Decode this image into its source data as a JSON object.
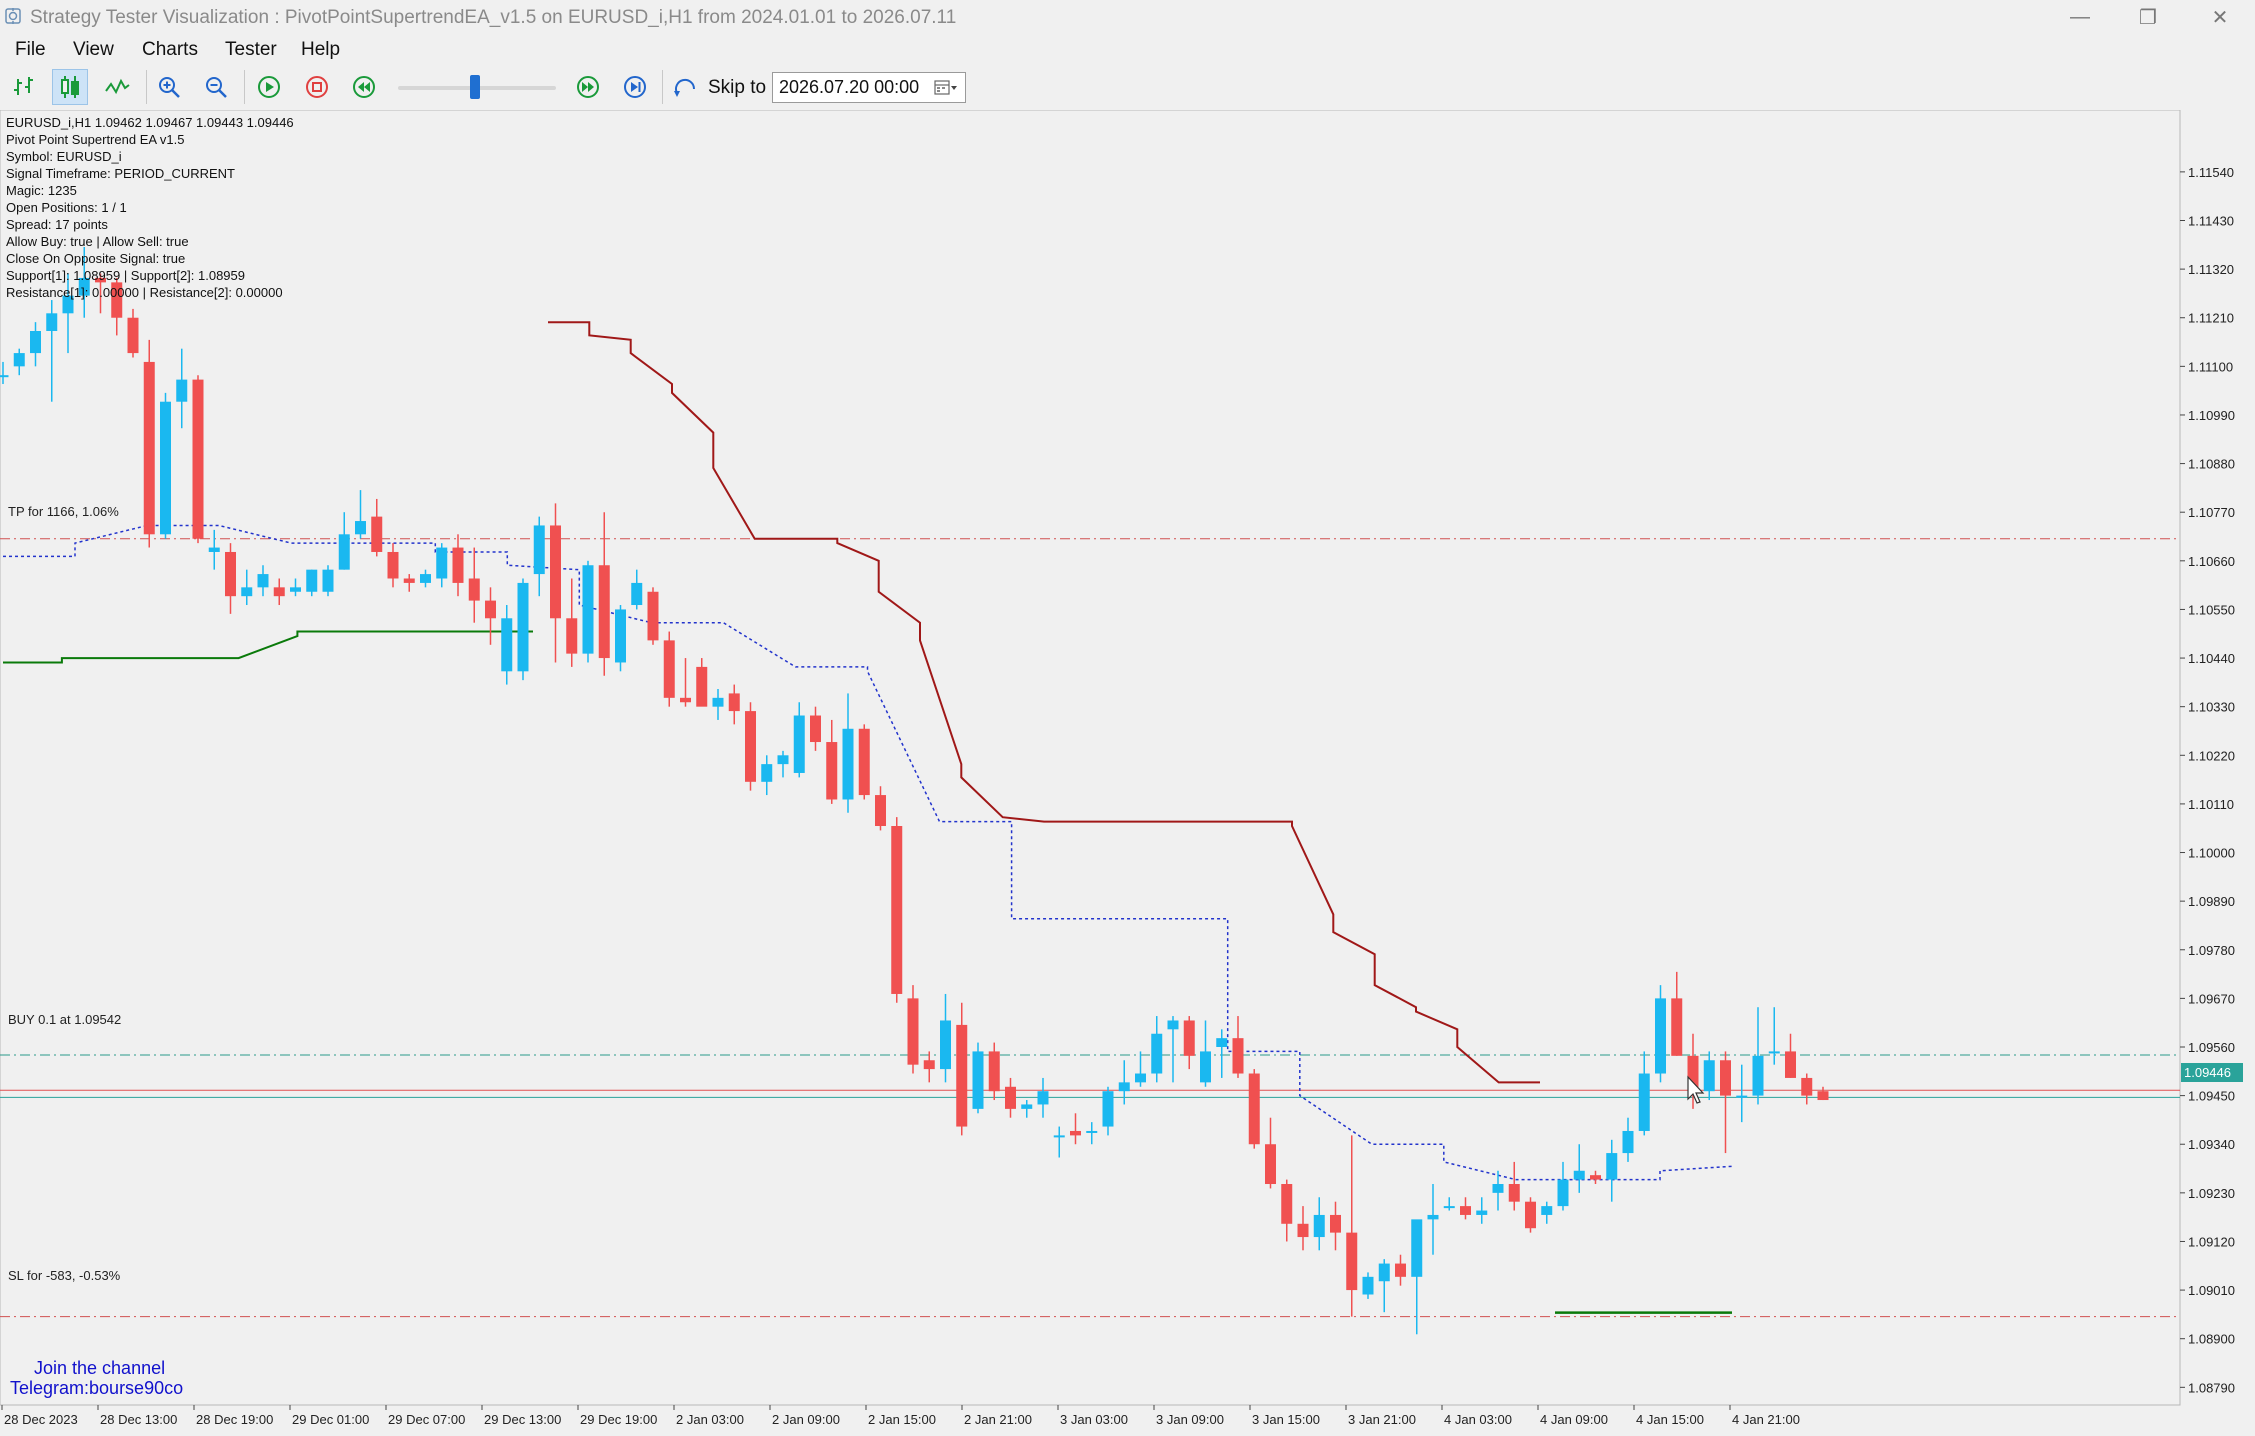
{
  "window": {
    "title": "Strategy Tester Visualization : PivotPointSupertrendEA_v1.5 on EURUSD_i,H1 from 2024.01.01 to 2026.07.11",
    "minimize": "—",
    "restore": "❐",
    "close": "✕"
  },
  "menu": {
    "file": "File",
    "view": "View",
    "charts": "Charts",
    "tester": "Tester",
    "help": "Help"
  },
  "toolbar": {
    "skip_label": "Skip to",
    "skip_date": "2026.07.20 00:00",
    "speed_fraction": 0.6
  },
  "info": {
    "line1": "EURUSD_i,H1  1.09462 1.09467 1.09443 1.09446",
    "line2": "Pivot Point Supertrend EA v1.5",
    "line3": "Symbol: EURUSD_i",
    "line4": "Signal Timeframe: PERIOD_CURRENT",
    "line5": "Magic: 1235",
    "line6": "Open Positions: 1 / 1",
    "line7": "Spread: 17 points",
    "line8": "Allow Buy: true | Allow Sell: true",
    "line9": "Close On Opposite Signal: true",
    "line10": "Support[1]: 1.08959 | Support[2]: 1.08959",
    "line11": "Resistance[1]: 0.00000 | Resistance[2]: 0.00000"
  },
  "levels": {
    "tp_label": "TP for 1166, 1.06%",
    "buy_label": "BUY 0.1 at 1.09542",
    "sl_label": "SL for -583, -0.53%",
    "current_price": "1.09446",
    "bid_hidden": "1.09462"
  },
  "watermark": {
    "line1": "Join the channel",
    "line2": "Telegram:bourse90co"
  },
  "colors": {
    "bull": "#1ab8f0",
    "bear": "#f05050",
    "supertrend_down": "#a01818",
    "supertrend_up": "#0a7a0a",
    "trail": "#2233cc"
  },
  "chart_data": {
    "type": "candlestick",
    "symbol": "EURUSD_i",
    "timeframe": "H1",
    "y_ticks": [
      "1.11540",
      "1.11430",
      "1.11320",
      "1.11210",
      "1.11100",
      "1.10990",
      "1.10880",
      "1.10770",
      "1.10660",
      "1.10550",
      "1.10440",
      "1.10330",
      "1.10220",
      "1.10110",
      "1.10000",
      "1.09890",
      "1.09780",
      "1.09670",
      "1.09560",
      "1.09450",
      "1.09340",
      "1.09230",
      "1.09120",
      "1.09010",
      "1.08900",
      "1.08790"
    ],
    "x_ticks": [
      "28 Dec 2023",
      "28 Dec 13:00",
      "28 Dec 19:00",
      "29 Dec 01:00",
      "29 Dec 07:00",
      "29 Dec 13:00",
      "29 Dec 19:00",
      "2 Jan 03:00",
      "2 Jan 09:00",
      "2 Jan 15:00",
      "2 Jan 21:00",
      "3 Jan 03:00",
      "3 Jan 09:00",
      "3 Jan 15:00",
      "3 Jan 21:00",
      "4 Jan 03:00",
      "4 Jan 09:00",
      "4 Jan 15:00",
      "4 Jan 21:00"
    ],
    "ylim": [
      1.0875,
      1.1168
    ],
    "levels": {
      "tp": 1.1071,
      "buy": 1.09542,
      "sl": 1.0895,
      "bid": 1.09462,
      "ask": 1.09446
    },
    "candles": [
      [
        1.1108,
        1.1111,
        1.1106,
        1.1108
      ],
      [
        1.111,
        1.1114,
        1.1108,
        1.1113
      ],
      [
        1.1113,
        1.112,
        1.111,
        1.1118
      ],
      [
        1.1118,
        1.1125,
        1.1102,
        1.1122
      ],
      [
        1.1122,
        1.1131,
        1.1113,
        1.1126
      ],
      [
        1.1126,
        1.1137,
        1.1121,
        1.113
      ],
      [
        1.113,
        1.1131,
        1.1122,
        1.1129
      ],
      [
        1.1129,
        1.113,
        1.1117,
        1.1121
      ],
      [
        1.1121,
        1.1123,
        1.1112,
        1.1113
      ],
      [
        1.1111,
        1.1116,
        1.1069,
        1.1072
      ],
      [
        1.1072,
        1.1104,
        1.1071,
        1.1102
      ],
      [
        1.1102,
        1.1114,
        1.1096,
        1.1107
      ],
      [
        1.1107,
        1.1108,
        1.107,
        1.1071
      ],
      [
        1.1068,
        1.1073,
        1.1064,
        1.1069
      ],
      [
        1.1068,
        1.107,
        1.1054,
        1.1058
      ],
      [
        1.1058,
        1.1064,
        1.1056,
        1.106
      ],
      [
        1.106,
        1.1065,
        1.1058,
        1.1063
      ],
      [
        1.106,
        1.1062,
        1.1056,
        1.1058
      ],
      [
        1.1059,
        1.1062,
        1.1058,
        1.106
      ],
      [
        1.1059,
        1.1064,
        1.1058,
        1.1064
      ],
      [
        1.1059,
        1.1065,
        1.1058,
        1.1064
      ],
      [
        1.1064,
        1.1077,
        1.1064,
        1.1072
      ],
      [
        1.1072,
        1.1082,
        1.1071,
        1.1075
      ],
      [
        1.1076,
        1.108,
        1.1067,
        1.1068
      ],
      [
        1.1068,
        1.107,
        1.106,
        1.1062
      ],
      [
        1.1062,
        1.1063,
        1.1059,
        1.1061
      ],
      [
        1.1061,
        1.1064,
        1.106,
        1.1063
      ],
      [
        1.1062,
        1.107,
        1.106,
        1.1069
      ],
      [
        1.1069,
        1.1072,
        1.1058,
        1.1061
      ],
      [
        1.1062,
        1.1069,
        1.1052,
        1.1057
      ],
      [
        1.1057,
        1.106,
        1.1047,
        1.1053
      ],
      [
        1.1041,
        1.1056,
        1.1038,
        1.1053
      ],
      [
        1.1041,
        1.1062,
        1.1039,
        1.1061
      ],
      [
        1.1063,
        1.1076,
        1.1058,
        1.1074
      ],
      [
        1.1074,
        1.1079,
        1.1043,
        1.1053
      ],
      [
        1.1053,
        1.1062,
        1.1042,
        1.1045
      ],
      [
        1.1045,
        1.1066,
        1.1043,
        1.1065
      ],
      [
        1.1065,
        1.1077,
        1.104,
        1.1044
      ],
      [
        1.1043,
        1.1056,
        1.1041,
        1.1055
      ],
      [
        1.1056,
        1.1064,
        1.1055,
        1.1061
      ],
      [
        1.1059,
        1.106,
        1.1047,
        1.1048
      ],
      [
        1.1048,
        1.105,
        1.1033,
        1.1035
      ],
      [
        1.1035,
        1.1044,
        1.1033,
        1.1034
      ],
      [
        1.1042,
        1.1044,
        1.1034,
        1.1033
      ],
      [
        1.1033,
        1.1037,
        1.103,
        1.1035
      ],
      [
        1.1036,
        1.1038,
        1.1029,
        1.1032
      ],
      [
        1.1032,
        1.1034,
        1.1014,
        1.1016
      ],
      [
        1.1016,
        1.1022,
        1.1013,
        1.102
      ],
      [
        1.102,
        1.1023,
        1.1017,
        1.1022
      ],
      [
        1.1018,
        1.1034,
        1.1017,
        1.1031
      ],
      [
        1.1031,
        1.1033,
        1.1023,
        1.1025
      ],
      [
        1.1025,
        1.103,
        1.1011,
        1.1012
      ],
      [
        1.1012,
        1.1036,
        1.1009,
        1.1028
      ],
      [
        1.1028,
        1.1029,
        1.1012,
        1.1013
      ],
      [
        1.1013,
        1.1015,
        1.1005,
        1.1006
      ],
      [
        1.1006,
        1.1008,
        1.0966,
        1.0968
      ],
      [
        1.0967,
        1.097,
        1.095,
        1.0952
      ],
      [
        1.0953,
        1.0955,
        1.0948,
        1.0951
      ],
      [
        1.0951,
        1.0968,
        1.0948,
        1.0962
      ],
      [
        1.0961,
        1.0966,
        1.0936,
        1.0938
      ],
      [
        1.0942,
        1.0957,
        1.0941,
        1.0955
      ],
      [
        1.0955,
        1.0957,
        1.0944,
        1.0946
      ],
      [
        1.0947,
        1.0949,
        1.094,
        1.0942
      ],
      [
        1.0942,
        1.0944,
        1.094,
        1.0943
      ],
      [
        1.0943,
        1.0949,
        1.094,
        1.0946
      ],
      [
        1.0936,
        1.0938,
        1.0931,
        1.0936
      ],
      [
        1.0937,
        1.0941,
        1.0934,
        1.0936
      ],
      [
        1.0937,
        1.0939,
        1.0934,
        1.0937
      ],
      [
        1.0938,
        1.0947,
        1.0936,
        1.0946
      ],
      [
        1.0946,
        1.0953,
        1.0943,
        1.0948
      ],
      [
        1.0948,
        1.0955,
        1.0947,
        1.095
      ],
      [
        1.095,
        1.0963,
        1.0948,
        1.0959
      ],
      [
        1.096,
        1.0963,
        1.0948,
        1.0962
      ],
      [
        1.0962,
        1.0963,
        1.0951,
        1.0954
      ],
      [
        1.0948,
        1.0962,
        1.0947,
        1.0955
      ],
      [
        1.0956,
        1.096,
        1.0949,
        1.0958
      ],
      [
        1.0958,
        1.0963,
        1.0949,
        1.095
      ],
      [
        1.095,
        1.0951,
        1.0933,
        1.0934
      ],
      [
        1.0934,
        1.094,
        1.0924,
        1.0925
      ],
      [
        1.0925,
        1.0926,
        1.0912,
        1.0916
      ],
      [
        1.0916,
        1.092,
        1.091,
        1.0913
      ],
      [
        1.0913,
        1.0922,
        1.091,
        1.0918
      ],
      [
        1.0918,
        1.0921,
        1.091,
        1.0914
      ],
      [
        1.0914,
        1.0936,
        1.0895,
        1.0901
      ],
      [
        1.09,
        1.0905,
        1.0899,
        1.0904
      ],
      [
        1.0903,
        1.0908,
        1.0896,
        1.0907
      ],
      [
        1.0907,
        1.0909,
        1.0902,
        1.0904
      ],
      [
        1.0904,
        1.0909,
        1.0891,
        1.0917
      ],
      [
        1.0917,
        1.0925,
        1.0909,
        1.0918
      ],
      [
        1.092,
        1.0922,
        1.0919,
        1.092
      ],
      [
        1.092,
        1.0922,
        1.0917,
        1.0918
      ],
      [
        1.0918,
        1.0922,
        1.0916,
        1.0919
      ],
      [
        1.0923,
        1.0928,
        1.0919,
        1.0925
      ],
      [
        1.0925,
        1.093,
        1.0919,
        1.0921
      ],
      [
        1.0921,
        1.0922,
        1.0914,
        1.0915
      ],
      [
        1.0918,
        1.0921,
        1.0916,
        1.092
      ],
      [
        1.092,
        1.093,
        1.0919,
        1.0926
      ],
      [
        1.0926,
        1.0934,
        1.0923,
        1.0928
      ],
      [
        1.0927,
        1.0928,
        1.0925,
        1.0926
      ],
      [
        1.0926,
        1.0935,
        1.0921,
        1.0932
      ],
      [
        1.0932,
        1.094,
        1.093,
        1.0937
      ],
      [
        1.0937,
        1.0955,
        1.0936,
        1.095
      ],
      [
        1.095,
        1.097,
        1.0948,
        1.0967
      ],
      [
        1.0967,
        1.0973,
        1.0954,
        1.0954
      ],
      [
        1.0954,
        1.0959,
        1.0942,
        1.0946
      ],
      [
        1.0946,
        1.0955,
        1.0944,
        1.0953
      ],
      [
        1.0953,
        1.0955,
        1.0932,
        1.0945
      ],
      [
        1.0945,
        1.0952,
        1.0939,
        1.0945
      ],
      [
        1.0945,
        1.0965,
        1.0943,
        1.0954
      ],
      [
        1.0955,
        1.0965,
        1.0952,
        1.0955
      ],
      [
        1.0955,
        1.0959,
        1.0949,
        1.0949
      ],
      [
        1.0949,
        1.095,
        1.0943,
        1.0945
      ],
      [
        1.0946,
        1.0947,
        1.0944,
        1.0944
      ]
    ],
    "supertrend_down": [
      [
        1.112,
        1.112
      ],
      [
        1.1117,
        1.1116
      ],
      [
        1.1113,
        1.1106
      ],
      [
        1.1104,
        1.1095
      ],
      [
        1.1087,
        1.1071
      ],
      [
        1.1071,
        1.1071
      ],
      [
        1.1071,
        1.1071
      ],
      [
        1.107,
        1.1066
      ],
      [
        1.1059,
        1.1052
      ],
      [
        1.1048,
        1.102
      ],
      [
        1.1017,
        1.1008
      ],
      [
        1.1008,
        1.1007
      ],
      [
        1.1007,
        1.1007
      ],
      [
        1.1007,
        1.1007
      ],
      [
        1.1007,
        1.1007
      ],
      [
        1.1007,
        1.1007
      ],
      [
        1.1007,
        1.1007
      ],
      [
        1.1007,
        1.1007
      ],
      [
        1.1006,
        1.0986
      ],
      [
        1.0982,
        1.0977
      ],
      [
        1.097,
        1.0965
      ],
      [
        1.0964,
        1.096
      ],
      [
        1.0956,
        1.0948
      ],
      [
        1.0948,
        1.0948
      ]
    ],
    "supertrend_up": [
      [
        1.1043,
        1.1043
      ],
      [
        1.1044,
        1.1044
      ],
      [
        1.1044,
        1.1044
      ],
      [
        1.1044,
        1.1044
      ],
      [
        1.1044,
        1.1049
      ],
      [
        1.105,
        1.105
      ],
      [
        1.105,
        1.105
      ],
      [
        1.105,
        1.105
      ],
      [
        1.105,
        1.105
      ]
    ],
    "trail": [
      [
        1.1067,
        1.1067
      ],
      [
        1.107,
        1.1074
      ],
      [
        1.1074,
        1.1074
      ],
      [
        1.1074,
        1.107
      ],
      [
        1.107,
        1.107
      ],
      [
        1.107,
        1.107
      ],
      [
        1.1068,
        1.1068
      ],
      [
        1.1065,
        1.1064
      ],
      [
        1.1056,
        1.1052
      ],
      [
        1.1052,
        1.1052
      ],
      [
        1.1052,
        1.1042
      ],
      [
        1.1042,
        1.1042
      ],
      [
        1.1041,
        1.1007
      ],
      [
        1.1007,
        1.1007
      ],
      [
        1.0985,
        1.0985
      ],
      [
        1.0985,
        1.0985
      ],
      [
        1.0985,
        1.0985
      ],
      [
        1.0955,
        1.0955
      ],
      [
        1.0945,
        1.0934
      ],
      [
        1.0934,
        1.0934
      ],
      [
        1.093,
        1.0926
      ],
      [
        1.0926,
        1.0926
      ],
      [
        1.0926,
        1.0926
      ],
      [
        1.0928,
        1.0929
      ]
    ],
    "sl_green": [
      1.08959,
      1.08959
    ]
  }
}
